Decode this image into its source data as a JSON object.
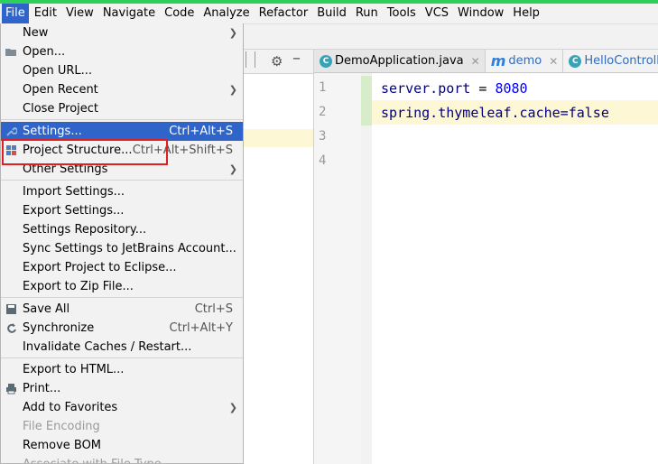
{
  "menubar": [
    "File",
    "Edit",
    "View",
    "Navigate",
    "Code",
    "Analyze",
    "Refactor",
    "Build",
    "Run",
    "Tools",
    "VCS",
    "Window",
    "Help"
  ],
  "file_menu": {
    "new": "New",
    "open": "Open...",
    "open_url": "Open URL...",
    "open_recent": "Open Recent",
    "close_project": "Close Project",
    "settings": "Settings...",
    "settings_sc": "Ctrl+Alt+S",
    "project_structure": "Project Structure...",
    "project_structure_sc": "Ctrl+Alt+Shift+S",
    "other_settings": "Other Settings",
    "import_settings": "Import Settings...",
    "export_settings": "Export Settings...",
    "settings_repository": "Settings Repository...",
    "sync_settings": "Sync Settings to JetBrains Account...",
    "export_eclipse": "Export Project to Eclipse...",
    "export_zip": "Export to Zip File...",
    "save_all": "Save All",
    "save_all_sc": "Ctrl+S",
    "synchronize": "Synchronize",
    "synchronize_sc": "Ctrl+Alt+Y",
    "invalidate": "Invalidate Caches / Restart...",
    "export_html": "Export to HTML...",
    "print": "Print...",
    "add_favorites": "Add to Favorites",
    "file_encoding": "File Encoding",
    "remove_bom": "Remove BOM",
    "associate": "Associate with File Type..."
  },
  "tabs": [
    "DemoApplication.java",
    "demo",
    "HelloController.ja"
  ],
  "code": {
    "lines": [
      "1",
      "2",
      "3",
      "4"
    ],
    "l1_key": "server.port",
    "l1_eq": " = ",
    "l1_val": "8080",
    "l2": "spring.thymeleaf.cache=false"
  },
  "colors": {
    "selection": "#2f65ca",
    "highlight_box": "#e02020",
    "accent_bar": "#2ecf5b"
  }
}
